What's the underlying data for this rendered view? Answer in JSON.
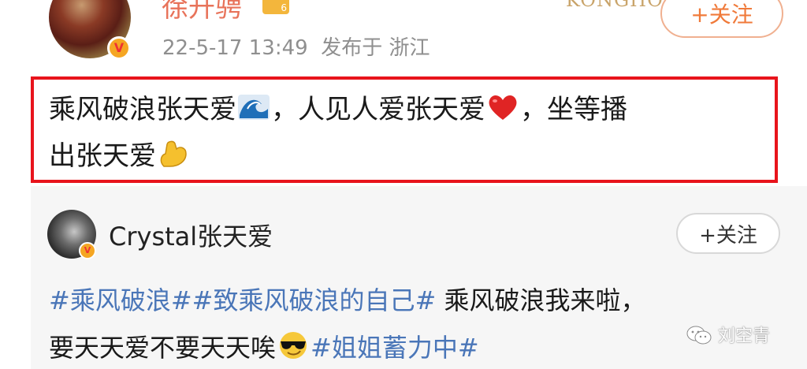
{
  "post": {
    "author_name": "徐升骋",
    "vip_level": "6",
    "brand_mark": "KONGHO",
    "follow_label": "+关注",
    "timestamp": "22-5-17 13:49",
    "location": "发布于 浙江",
    "text_line1_a": "乘风破浪张天爱",
    "text_line1_b": "，人见人爱张天爱",
    "text_line1_c": "，坐等播",
    "text_line2": "出张天爱",
    "emojis": [
      "wave-emoji",
      "heart-emoji",
      "flexed-biceps-emoji"
    ]
  },
  "repost": {
    "author_name": "Crystal张天爱",
    "follow_label": "+关注",
    "tag1": "#乘风破浪#",
    "tag2": "#致乘风破浪的自己#",
    "line1_text": " 乘风破浪我来啦，",
    "line2_text": "要天天爱不要天天唉",
    "tag3": "#姐姐蓄力中#",
    "emojis": [
      "sunglasses-emoji"
    ]
  },
  "watermark": {
    "text": "刘空青",
    "icon": "wechat-icon"
  },
  "colors": {
    "highlight_border": "#e8141c",
    "tag_blue": "#4a76b8",
    "follow_orange": "#f07a3a",
    "repost_bg": "#f6f6f6"
  }
}
